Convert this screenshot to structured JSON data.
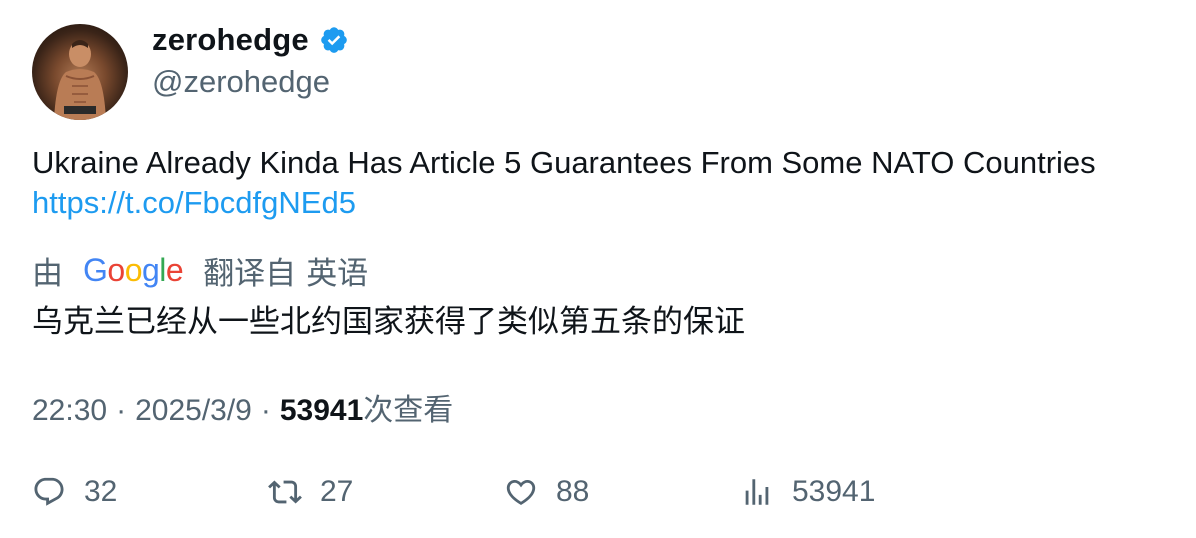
{
  "user": {
    "display_name": "zerohedge",
    "handle": "@zerohedge",
    "verified": true
  },
  "tweet": {
    "text": "Ukraine Already Kinda Has Article 5 Guarantees From Some NATO Countries",
    "link": "https://t.co/FbcdfgNEd5"
  },
  "translation": {
    "prefix": "由",
    "provider": "Google",
    "suffix": "翻译自",
    "language": "英语",
    "text": "乌克兰已经从一些北约国家获得了类似第五条的保证"
  },
  "meta": {
    "time": "22:30",
    "separator": "·",
    "date": "2025/3/9",
    "views": "53941",
    "views_label": "次查看"
  },
  "actions": {
    "replies": "32",
    "retweets": "27",
    "likes": "88",
    "views": "53941"
  },
  "colors": {
    "link": "#1d9bf0",
    "secondary_text": "#536471",
    "primary_text": "#0f1419",
    "verified": "#1d9bf0"
  },
  "icons": {
    "verified": "verified-badge-icon",
    "reply": "reply-icon",
    "retweet": "retweet-icon",
    "like": "heart-icon",
    "views": "analytics-icon"
  }
}
